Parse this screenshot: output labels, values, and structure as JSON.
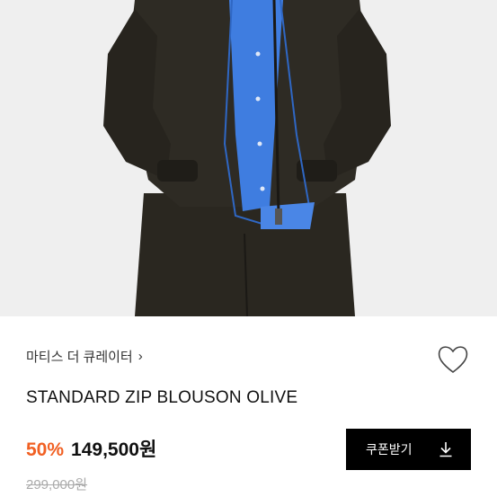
{
  "product": {
    "brand_label": "마티스 더 큐레이터",
    "brand_chevron": "›",
    "name": "STANDARD ZIP BLOUSON OLIVE",
    "discount": "50%",
    "price": "149,500원",
    "original_price": "299,000원"
  },
  "coupon": {
    "label": "쿠폰받기",
    "icon": "download-icon"
  },
  "icons": {
    "wishlist": "heart-outline-icon"
  },
  "colors": {
    "accent_discount": "#f16023",
    "button_bg": "#000000",
    "jacket": "#2e2b24",
    "shirt": "#3f7de0"
  }
}
